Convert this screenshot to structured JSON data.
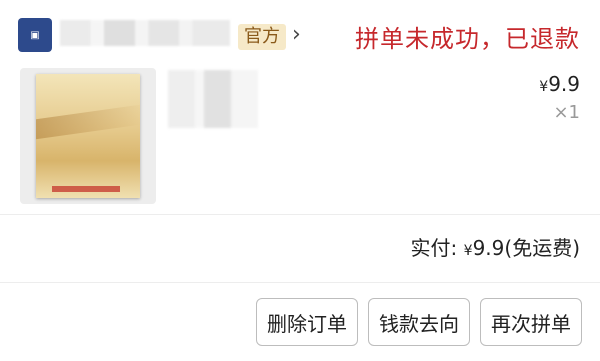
{
  "header": {
    "official_badge": "官方",
    "chevron": "›",
    "status": "拼单未成功，已退款"
  },
  "product": {
    "price_symbol": "¥",
    "price": "9.9",
    "quantity": "×1"
  },
  "summary": {
    "label": "实付:",
    "price_symbol": "¥",
    "amount": "9.9",
    "shipping_note": "(免运费)"
  },
  "actions": {
    "delete": "删除订单",
    "refund_flow": "钱款去向",
    "regroup": "再次拼单"
  }
}
